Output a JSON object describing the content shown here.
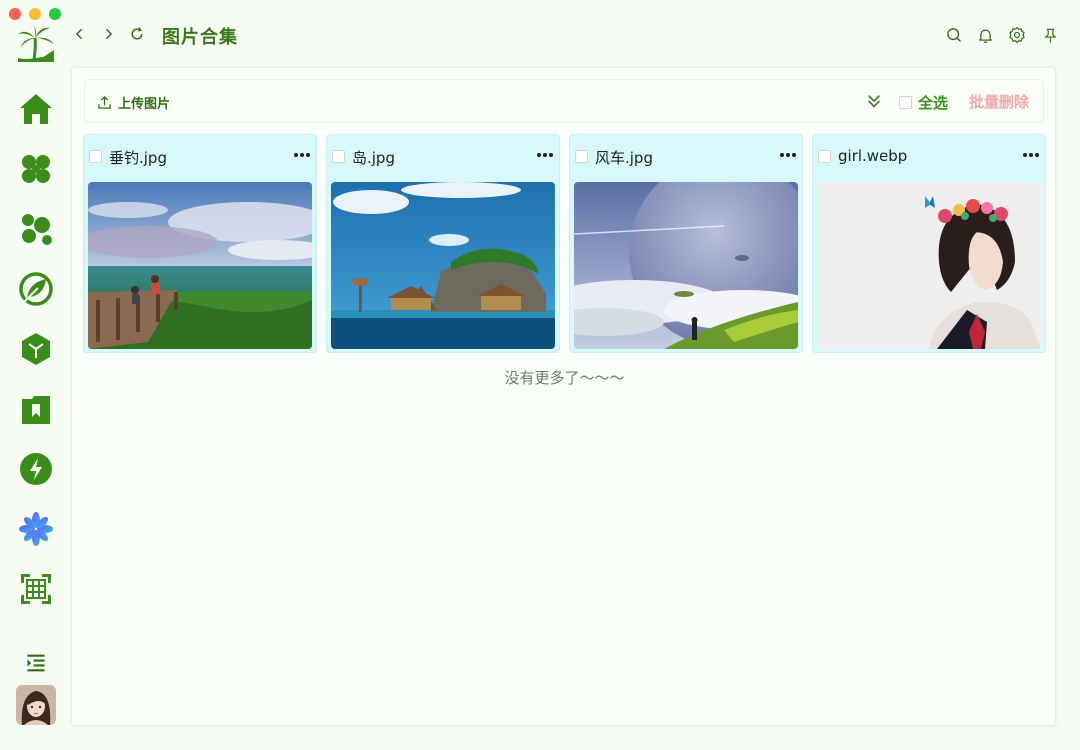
{
  "window": {
    "title": "图片合集"
  },
  "topbar": {
    "back_icon": "chevron-left-icon",
    "forward_icon": "chevron-right-icon",
    "refresh_icon": "refresh-icon",
    "title": "图片合集",
    "actions": [
      "search-icon",
      "bell-icon",
      "gear-icon",
      "pin-icon"
    ]
  },
  "sidebar": {
    "items": [
      "home-icon",
      "clover-icon",
      "bubbles-icon",
      "leaf-icon",
      "cube-icon",
      "bookmark-folder-icon",
      "lightning-icon",
      "flower-icon",
      "grid-icon"
    ],
    "collapse_icon": "menu-indent-icon"
  },
  "toolbar": {
    "upload_label": "上传图片",
    "select_all_label": "全选",
    "batch_delete_label": "批量删除"
  },
  "images": [
    {
      "name": "垂钓.jpg"
    },
    {
      "name": "岛.jpg"
    },
    {
      "name": "风车.jpg"
    },
    {
      "name": "girl.webp"
    }
  ],
  "footer_text": "没有更多了～～～",
  "colors": {
    "accent": "#3a7a1c",
    "card_bg": "#d8f9fb",
    "delete": "#f4a8a8"
  }
}
